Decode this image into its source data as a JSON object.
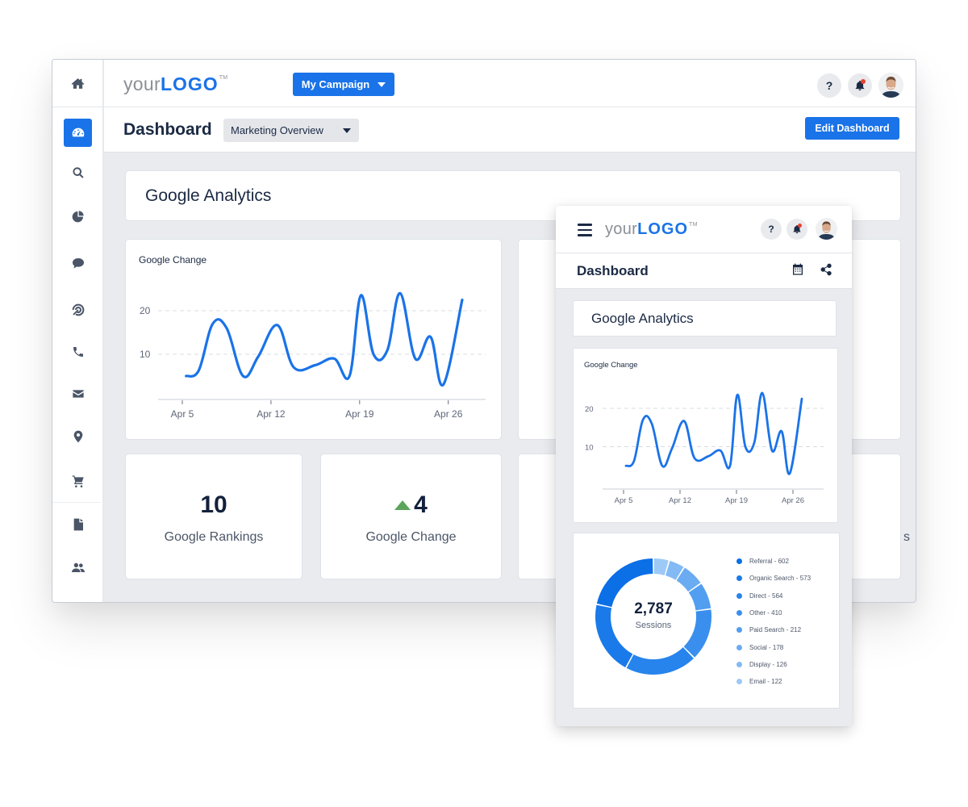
{
  "app": {
    "logo_prefix": "your",
    "logo_brand": "LOGO",
    "logo_tm": "TM",
    "campaign_button": "My Campaign",
    "help_label": "?",
    "page_title": "Dashboard",
    "dashboard_select": "Marketing Overview",
    "edit_button": "Edit Dashboard"
  },
  "sidebar": {
    "items": [
      {
        "name": "home",
        "icon": "home-icon",
        "active": false
      },
      {
        "name": "dashboard",
        "icon": "dashboard-gauge-icon",
        "active": true
      },
      {
        "name": "search",
        "icon": "search-icon",
        "active": false
      },
      {
        "name": "reports",
        "icon": "pie-chart-icon",
        "active": false
      },
      {
        "name": "messages",
        "icon": "chat-bubble-icon",
        "active": false
      },
      {
        "name": "goals",
        "icon": "target-icon",
        "active": false
      },
      {
        "name": "calls",
        "icon": "phone-icon",
        "active": false
      },
      {
        "name": "email",
        "icon": "envelope-icon",
        "active": false
      },
      {
        "name": "locations",
        "icon": "map-pin-icon",
        "active": false
      },
      {
        "name": "ecommerce",
        "icon": "cart-icon",
        "active": false
      },
      {
        "name": "documents",
        "icon": "document-icon",
        "active": false
      },
      {
        "name": "users",
        "icon": "users-icon",
        "active": false
      }
    ]
  },
  "main": {
    "section_title": "Google Analytics",
    "chart_title": "Google Change",
    "kpis": [
      {
        "value": "10",
        "label": "Google Rankings",
        "trend": null
      },
      {
        "value": "4",
        "label": "Google Change",
        "trend": "up"
      }
    ],
    "hidden_label_fragment": "s",
    "colors": {
      "accent": "#1a73e8",
      "trend_up": "#5ba55a",
      "notification": "#e8412f"
    }
  },
  "mobile": {
    "logo_prefix": "your",
    "logo_brand": "LOGO",
    "logo_tm": "TM",
    "help_label": "?",
    "page_title": "Dashboard",
    "section_title": "Google Analytics",
    "chart_title": "Google Change",
    "donut_total": "2,787",
    "donut_label": "Sessions"
  },
  "chart_data": [
    {
      "type": "line",
      "title": "Google Change",
      "xlabel": "",
      "ylabel": "",
      "x_ticks": [
        "Apr 5",
        "Apr 12",
        "Apr 19",
        "Apr 26"
      ],
      "x_tick_days": [
        5,
        12,
        19,
        26
      ],
      "y_ticks": [
        10,
        20
      ],
      "ylim": [
        0,
        25
      ],
      "grid": "horizontal-dashed",
      "series": [
        {
          "name": "Google Change",
          "color": "#1a73e8",
          "x": [
            5.3,
            6.3,
            7.4,
            8.5,
            9.8,
            11.0,
            12.5,
            13.8,
            15.5,
            17.0,
            18.2,
            19.1,
            20.1,
            21.2,
            22.2,
            23.4,
            24.6,
            25.6,
            27.1
          ],
          "values": [
            5,
            6.3,
            17,
            16,
            5,
            9.5,
            16.7,
            7,
            7.5,
            9,
            5,
            23.5,
            10,
            11,
            24,
            9,
            14,
            3,
            22.5
          ]
        }
      ]
    },
    {
      "type": "pie",
      "title": "Sessions",
      "total": 2787,
      "categories": [
        "Referral",
        "Organic Search",
        "Direct",
        "Other",
        "Paid Search",
        "Social",
        "Display",
        "Email"
      ],
      "values": [
        602,
        573,
        564,
        410,
        212,
        178,
        126,
        122
      ],
      "colors": [
        "#0b6fe6",
        "#1a7ae9",
        "#2684ec",
        "#3a8fee",
        "#529ef0",
        "#6aabf2",
        "#83baf5",
        "#9dc9f7"
      ]
    }
  ]
}
